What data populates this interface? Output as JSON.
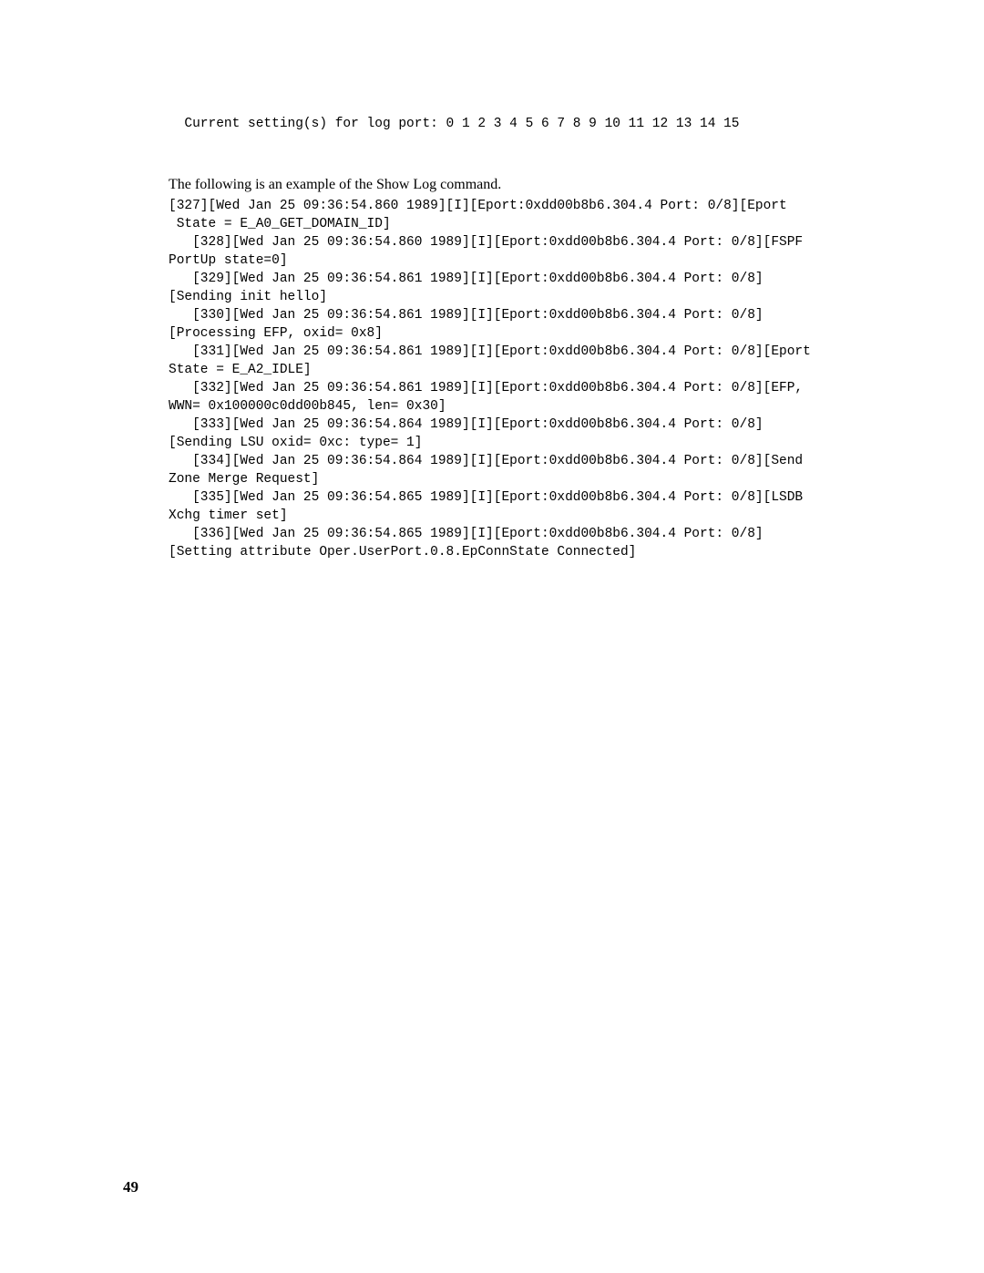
{
  "settings_line": "  Current setting(s) for log port: 0 1 2 3 4 5 6 7 8 9 10 11 12 13 14 15",
  "intro_text": "The following is an example of the Show Log command.",
  "log_lines": [
    "[327][Wed Jan 25 09:36:54.860 1989][I][Eport:0xdd00b8b6.304.4 Port: 0/8][Eport",
    " State = E_A0_GET_DOMAIN_ID]",
    "   [328][Wed Jan 25 09:36:54.860 1989][I][Eport:0xdd00b8b6.304.4 Port: 0/8][FSPF PortUp state=0]",
    "   [329][Wed Jan 25 09:36:54.861 1989][I][Eport:0xdd00b8b6.304.4 Port: 0/8][Sending init hello]",
    "   [330][Wed Jan 25 09:36:54.861 1989][I][Eport:0xdd00b8b6.304.4 Port: 0/8][Processing EFP, oxid= 0x8]",
    "   [331][Wed Jan 25 09:36:54.861 1989][I][Eport:0xdd00b8b6.304.4 Port: 0/8][Eport State = E_A2_IDLE]",
    "   [332][Wed Jan 25 09:36:54.861 1989][I][Eport:0xdd00b8b6.304.4 Port: 0/8][EFP, WWN= 0x100000c0dd00b845, len= 0x30]",
    "   [333][Wed Jan 25 09:36:54.864 1989][I][Eport:0xdd00b8b6.304.4 Port: 0/8][Sending LSU oxid= 0xc: type= 1]",
    "   [334][Wed Jan 25 09:36:54.864 1989][I][Eport:0xdd00b8b6.304.4 Port: 0/8][Send Zone Merge Request]",
    "   [335][Wed Jan 25 09:36:54.865 1989][I][Eport:0xdd00b8b6.304.4 Port: 0/8][LSDB Xchg timer set]",
    "   [336][Wed Jan 25 09:36:54.865 1989][I][Eport:0xdd00b8b6.304.4 Port: 0/8][Setting attribute Oper.UserPort.0.8.EpConnState Connected]"
  ],
  "page_number": "49"
}
